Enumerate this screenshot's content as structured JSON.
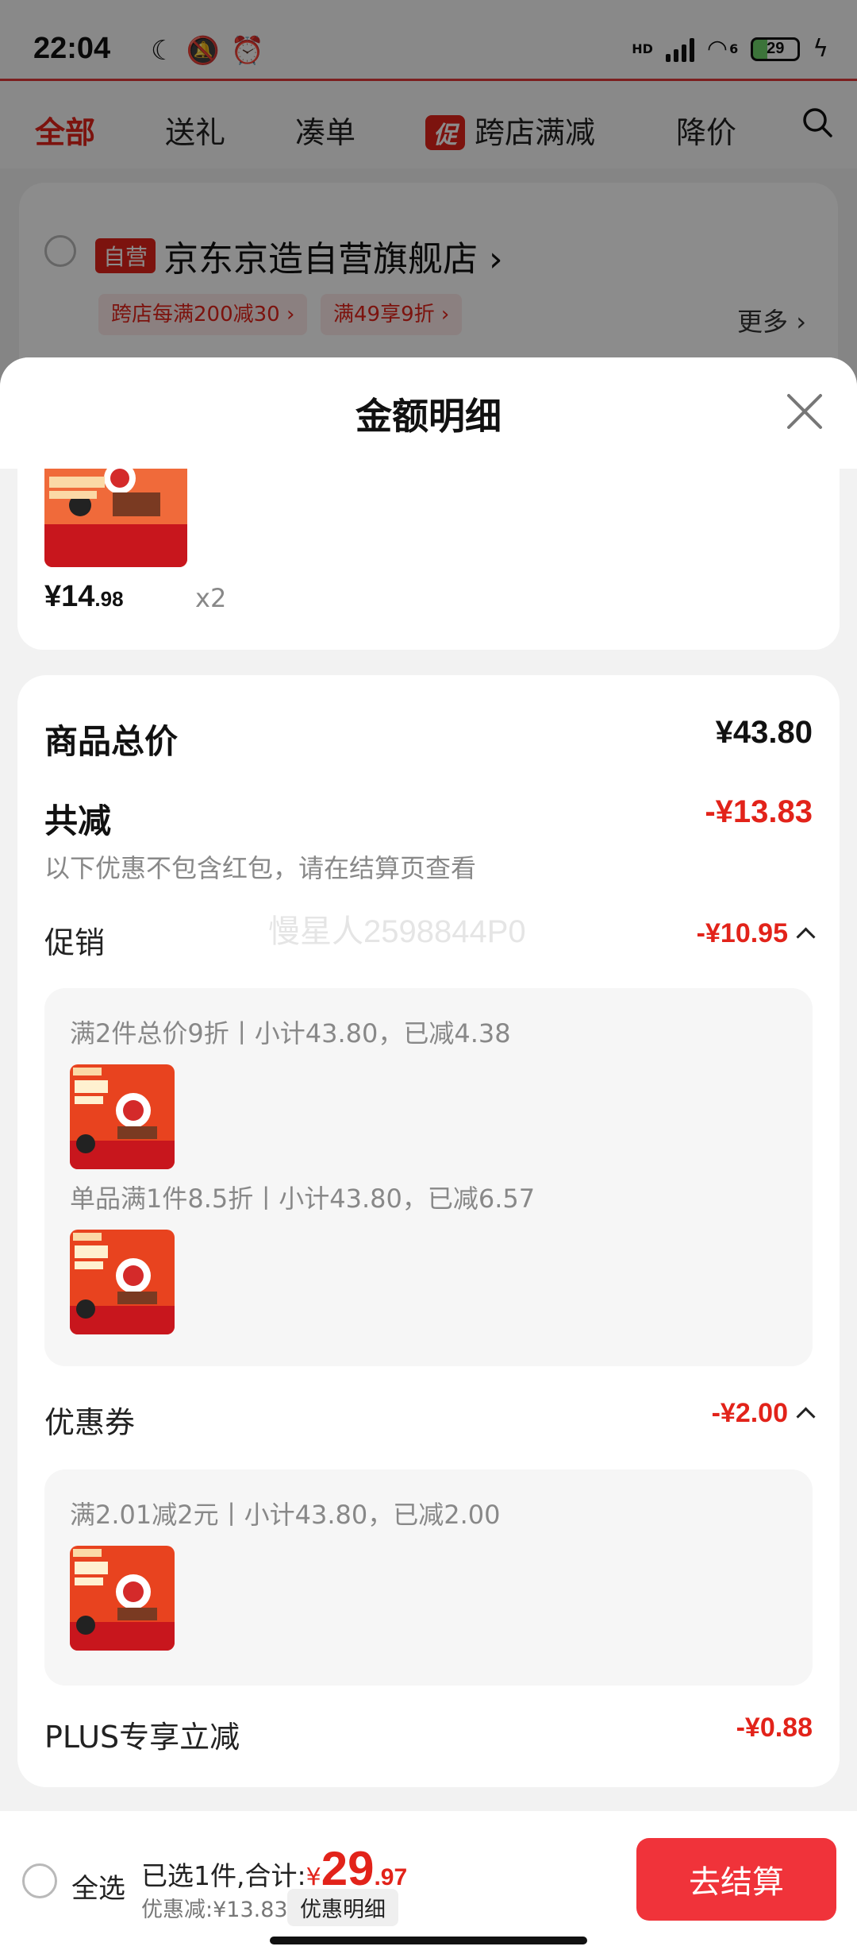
{
  "status_bar": {
    "time": "22:04",
    "network_label": "HD",
    "wifi_badge": "6",
    "battery_level": "29"
  },
  "top_tabs": [
    {
      "label": "全部",
      "active": true
    },
    {
      "label": "送礼",
      "active": false
    },
    {
      "label": "凑单",
      "active": false
    },
    {
      "label": "跨店满减",
      "badge": "促",
      "active": false
    },
    {
      "label": "降价",
      "active": false
    }
  ],
  "shop": {
    "tag": "自营",
    "name": "京东京造自营旗舰店",
    "chips": [
      "跨店每满200减30 ›",
      "满49享9折 ›"
    ],
    "more": "更多 ›"
  },
  "sheet": {
    "title": "金额明细",
    "product": {
      "price_int": "¥14",
      "price_dec": ".98",
      "qty": "x2"
    },
    "total_label": "商品总价",
    "total_value": "¥43.80",
    "discount_label": "共减",
    "discount_value": "-¥13.83",
    "discount_note": "以下优惠不包含红包，请在结算页查看",
    "watermark": "慢星人2598844P0",
    "promo": {
      "label": "促销",
      "value": "-¥10.95",
      "items": [
        {
          "text": "满2件总价9折丨小计43.80，已减4.38"
        },
        {
          "text": "单品满1件8.5折丨小计43.80，已减6.57"
        }
      ]
    },
    "coupon": {
      "label": "优惠券",
      "value": "-¥2.00",
      "items": [
        {
          "text": "满2.01减2元丨小计43.80，已减2.00"
        }
      ]
    },
    "plus": {
      "label": "PLUS专享立减",
      "value": "-¥0.88"
    }
  },
  "bottom_bar": {
    "select_all": "全选",
    "selected_prefix": "已选1件,合计:",
    "yen": "¥",
    "total_int": "29",
    "total_dec": ".97",
    "saved": "优惠减:¥13.83",
    "detail_pill": "优惠明细",
    "checkout": "去结算"
  },
  "colors": {
    "accent": "#e2231a",
    "checkout": "#f0333a"
  }
}
